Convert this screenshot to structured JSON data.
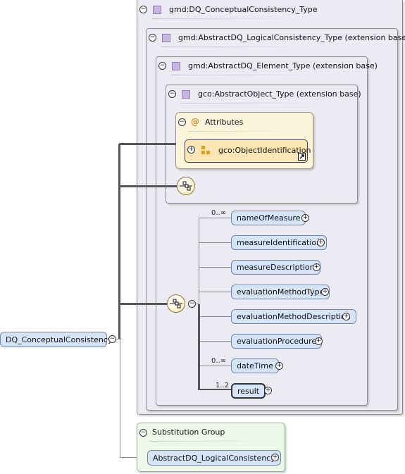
{
  "diagram": {
    "outer_type": "gmd:DQ_ConceptualConsistency_Type",
    "logical_type": "gmd:AbstractDQ_LogicalConsistency_Type (extension base)",
    "element_type": "gmd:AbstractDQ_Element_Type (extension base)",
    "object_type": "gco:AbstractObject_Type (extension base)",
    "attributes": {
      "title": "Attributes",
      "at_symbol": "@",
      "item": "gco:ObjectIdentification"
    },
    "root_element": "DQ_ConceptualConsistency",
    "sequence_elements": [
      {
        "name": "nameOfMeasure",
        "multiplicity": "0..∞"
      },
      {
        "name": "measureIdentification",
        "multiplicity": ""
      },
      {
        "name": "measureDescription",
        "multiplicity": ""
      },
      {
        "name": "evaluationMethodType",
        "multiplicity": ""
      },
      {
        "name": "evaluationMethodDescription",
        "multiplicity": ""
      },
      {
        "name": "evaluationProcedure",
        "multiplicity": ""
      },
      {
        "name": "dateTime",
        "multiplicity": "0..∞"
      },
      {
        "name": "result",
        "multiplicity": "1..2"
      }
    ],
    "substitution_group": {
      "title": "Substitution Group",
      "element": "AbstractDQ_LogicalConsistency"
    },
    "toggle_minus": "−",
    "toggle_plus": "+"
  }
}
